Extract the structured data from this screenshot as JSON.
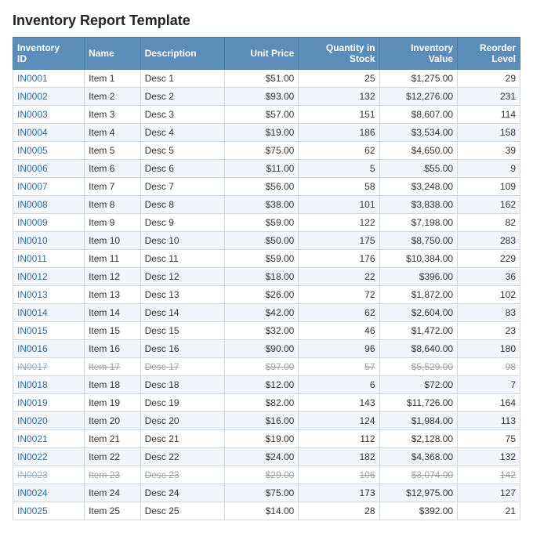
{
  "title": "Inventory Report Template",
  "columns": [
    {
      "label": "Inventory ID",
      "key": "id"
    },
    {
      "label": "Name",
      "key": "name"
    },
    {
      "label": "Description",
      "key": "desc"
    },
    {
      "label": "Unit Price",
      "key": "price"
    },
    {
      "label": "Quantity in Stock",
      "key": "qty"
    },
    {
      "label": "Inventory Value",
      "key": "value"
    },
    {
      "label": "Reorder Level",
      "key": "reorder"
    }
  ],
  "rows": [
    {
      "id": "IN0001",
      "name": "Item 1",
      "desc": "Desc 1",
      "price": "$51.00",
      "qty": "25",
      "value": "$1,275.00",
      "reorder": "29",
      "strike": false
    },
    {
      "id": "IN0002",
      "name": "Item 2",
      "desc": "Desc 2",
      "price": "$93.00",
      "qty": "132",
      "value": "$12,276.00",
      "reorder": "231",
      "strike": false
    },
    {
      "id": "IN0003",
      "name": "Item 3",
      "desc": "Desc 3",
      "price": "$57.00",
      "qty": "151",
      "value": "$8,607.00",
      "reorder": "114",
      "strike": false
    },
    {
      "id": "IN0004",
      "name": "Item 4",
      "desc": "Desc 4",
      "price": "$19.00",
      "qty": "186",
      "value": "$3,534.00",
      "reorder": "158",
      "strike": false
    },
    {
      "id": "IN0005",
      "name": "Item 5",
      "desc": "Desc 5",
      "price": "$75.00",
      "qty": "62",
      "value": "$4,650.00",
      "reorder": "39",
      "strike": false
    },
    {
      "id": "IN0006",
      "name": "Item 6",
      "desc": "Desc 6",
      "price": "$11.00",
      "qty": "5",
      "value": "$55.00",
      "reorder": "9",
      "strike": false
    },
    {
      "id": "IN0007",
      "name": "Item 7",
      "desc": "Desc 7",
      "price": "$56.00",
      "qty": "58",
      "value": "$3,248.00",
      "reorder": "109",
      "strike": false
    },
    {
      "id": "IN0008",
      "name": "Item 8",
      "desc": "Desc 8",
      "price": "$38.00",
      "qty": "101",
      "value": "$3,838.00",
      "reorder": "162",
      "strike": false
    },
    {
      "id": "IN0009",
      "name": "Item 9",
      "desc": "Desc 9",
      "price": "$59.00",
      "qty": "122",
      "value": "$7,198.00",
      "reorder": "82",
      "strike": false
    },
    {
      "id": "IN0010",
      "name": "Item 10",
      "desc": "Desc 10",
      "price": "$50.00",
      "qty": "175",
      "value": "$8,750.00",
      "reorder": "283",
      "strike": false
    },
    {
      "id": "IN0011",
      "name": "Item 11",
      "desc": "Desc 11",
      "price": "$59.00",
      "qty": "176",
      "value": "$10,384.00",
      "reorder": "229",
      "strike": false
    },
    {
      "id": "IN0012",
      "name": "Item 12",
      "desc": "Desc 12",
      "price": "$18.00",
      "qty": "22",
      "value": "$396.00",
      "reorder": "36",
      "strike": false
    },
    {
      "id": "IN0013",
      "name": "Item 13",
      "desc": "Desc 13",
      "price": "$26.00",
      "qty": "72",
      "value": "$1,872.00",
      "reorder": "102",
      "strike": false
    },
    {
      "id": "IN0014",
      "name": "Item 14",
      "desc": "Desc 14",
      "price": "$42.00",
      "qty": "62",
      "value": "$2,604.00",
      "reorder": "83",
      "strike": false
    },
    {
      "id": "IN0015",
      "name": "Item 15",
      "desc": "Desc 15",
      "price": "$32.00",
      "qty": "46",
      "value": "$1,472.00",
      "reorder": "23",
      "strike": false
    },
    {
      "id": "IN0016",
      "name": "Item 16",
      "desc": "Desc 16",
      "price": "$90.00",
      "qty": "96",
      "value": "$8,640.00",
      "reorder": "180",
      "strike": false
    },
    {
      "id": "IN0017",
      "name": "Item 17",
      "desc": "Desc 17",
      "price": "$97.00",
      "qty": "57",
      "value": "$5,529.00",
      "reorder": "98",
      "strike": true
    },
    {
      "id": "IN0018",
      "name": "Item 18",
      "desc": "Desc 18",
      "price": "$12.00",
      "qty": "6",
      "value": "$72.00",
      "reorder": "7",
      "strike": false
    },
    {
      "id": "IN0019",
      "name": "Item 19",
      "desc": "Desc 19",
      "price": "$82.00",
      "qty": "143",
      "value": "$11,726.00",
      "reorder": "164",
      "strike": false
    },
    {
      "id": "IN0020",
      "name": "Item 20",
      "desc": "Desc 20",
      "price": "$16.00",
      "qty": "124",
      "value": "$1,984.00",
      "reorder": "113",
      "strike": false
    },
    {
      "id": "IN0021",
      "name": "Item 21",
      "desc": "Desc 21",
      "price": "$19.00",
      "qty": "112",
      "value": "$2,128.00",
      "reorder": "75",
      "strike": false
    },
    {
      "id": "IN0022",
      "name": "Item 22",
      "desc": "Desc 22",
      "price": "$24.00",
      "qty": "182",
      "value": "$4,368.00",
      "reorder": "132",
      "strike": false
    },
    {
      "id": "IN0023",
      "name": "Item 23",
      "desc": "Desc 23",
      "price": "$29.00",
      "qty": "106",
      "value": "$3,074.00",
      "reorder": "142",
      "strike": true
    },
    {
      "id": "IN0024",
      "name": "Item 24",
      "desc": "Desc 24",
      "price": "$75.00",
      "qty": "173",
      "value": "$12,975.00",
      "reorder": "127",
      "strike": false
    },
    {
      "id": "IN0025",
      "name": "Item 25",
      "desc": "Desc 25",
      "price": "$14.00",
      "qty": "28",
      "value": "$392.00",
      "reorder": "21",
      "strike": false
    }
  ]
}
